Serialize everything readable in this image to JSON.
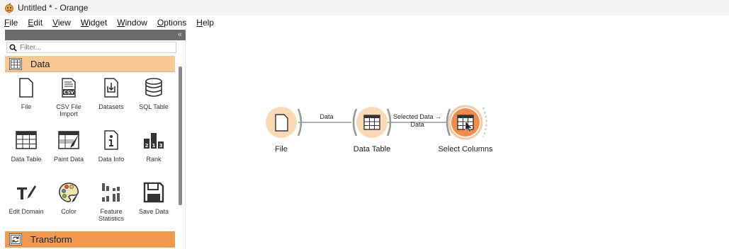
{
  "window": {
    "title": "Untitled * - Orange"
  },
  "menu": [
    "File",
    "Edit",
    "View",
    "Widget",
    "Window",
    "Options",
    "Help"
  ],
  "dock": {
    "collapse_glyph": "«",
    "filter_placeholder": "Filter...",
    "categories": {
      "data": "Data",
      "transform": "Transform"
    },
    "widgets": [
      {
        "label": "File",
        "icon": "file-icon"
      },
      {
        "label": "CSV File Import",
        "icon": "csv-icon"
      },
      {
        "label": "Datasets",
        "icon": "datasets-icon"
      },
      {
        "label": "SQL Table",
        "icon": "database-icon"
      },
      {
        "label": "Data Table",
        "icon": "table-icon"
      },
      {
        "label": "Paint Data",
        "icon": "paint-icon"
      },
      {
        "label": "Data Info",
        "icon": "info-icon"
      },
      {
        "label": "Rank",
        "icon": "rank-icon"
      },
      {
        "label": "Edit Domain",
        "icon": "edit-domain-icon"
      },
      {
        "label": "Color",
        "icon": "palette-icon"
      },
      {
        "label": "Feature Statistics",
        "icon": "bars-icon"
      },
      {
        "label": "Save Data",
        "icon": "save-icon"
      }
    ]
  },
  "canvas": {
    "nodes": [
      {
        "label": "File"
      },
      {
        "label": "Data Table"
      },
      {
        "label": "Select Columns"
      }
    ],
    "links": [
      {
        "label": "Data"
      },
      {
        "label": "Selected Data →",
        "label2": "Data"
      }
    ]
  },
  "colors": {
    "data_category": "#f8c995",
    "transform_category": "#f19a4f",
    "node_fill": "#fbd9b6",
    "node_active": "#f28c4c"
  }
}
